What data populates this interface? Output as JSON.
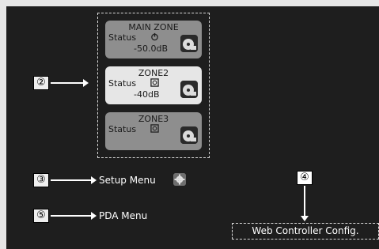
{
  "zones": [
    {
      "name": "MAIN ZONE",
      "status_label": "Status",
      "volume": "-50.0dB",
      "power_icon": "power-icon",
      "source_icon": "source-disc-icon"
    },
    {
      "name": "ZONE2",
      "status_label": "Status",
      "volume": "-40dB",
      "power_icon": "standby-icon",
      "source_icon": "source-disc-icon"
    },
    {
      "name": "ZONE3",
      "status_label": "Status",
      "volume": "",
      "power_icon": "standby-icon",
      "source_icon": "source-disc-icon"
    }
  ],
  "callouts": {
    "c2": "②",
    "c3": "③",
    "c4": "④",
    "c5": "⑤"
  },
  "menu": {
    "setup": "Setup Menu",
    "pda": "PDA Menu",
    "setup_icon": "gear-icon"
  },
  "web_config": "Web Controller Config.",
  "colors": {
    "panel": "#1e1e1e",
    "card_inactive": "#8e8e8e",
    "card_active": "#e6e6e6"
  }
}
